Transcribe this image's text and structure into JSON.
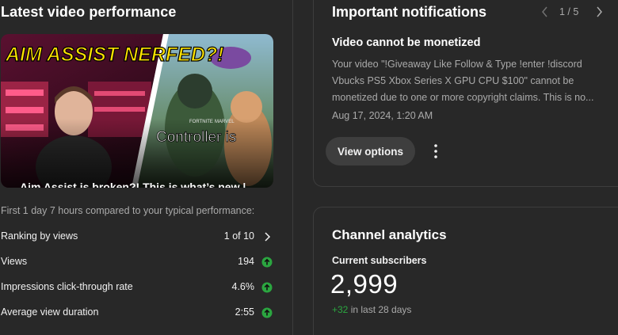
{
  "left": {
    "title": "Latest video performance",
    "video_title": "Aim Assist is broken?! This is what’s new | Dual Micro SMGs Monarch Pistol Sovereig...",
    "thumbnail_text_top": "AIM ASSIST NERFED?!",
    "thumbnail_text_bottom": "Controller is",
    "thumbnail_text_small1": "FORTNITE",
    "thumbnail_text_small2": "MARVEL",
    "compare_text": "First 1 day 7 hours compared to your typical performance:",
    "metrics": [
      {
        "label": "Ranking by views",
        "value": "1 of 10",
        "icon": "chevron-right-icon"
      },
      {
        "label": "Views",
        "value": "194",
        "icon": "up-arrow-circle-icon"
      },
      {
        "label": "Impressions click-through rate",
        "value": "4.6%",
        "icon": "up-arrow-circle-icon"
      },
      {
        "label": "Average view duration",
        "value": "2:55",
        "icon": "up-arrow-circle-icon"
      }
    ]
  },
  "notifications": {
    "title": "Important notifications",
    "pager": "1 / 5",
    "headline": "Video cannot be monetized",
    "body": "Your video \"!Giveaway Like Follow & Type !enter !discord Vbucks PS5 Xbox Series X GPU CPU $100\" cannot be monetized due to one or more copyright claims. This is no...",
    "time": "Aug 17, 2024, 1:20 AM",
    "view_options_label": "View options"
  },
  "analytics": {
    "title": "Channel analytics",
    "subscribers_label": "Current subscribers",
    "subscribers_count": "2,999",
    "delta": "+32",
    "delta_suffix": " in last 28 days"
  },
  "colors": {
    "background": "#282828",
    "positive": "#2ba640",
    "muted": "#aaaaaa"
  }
}
